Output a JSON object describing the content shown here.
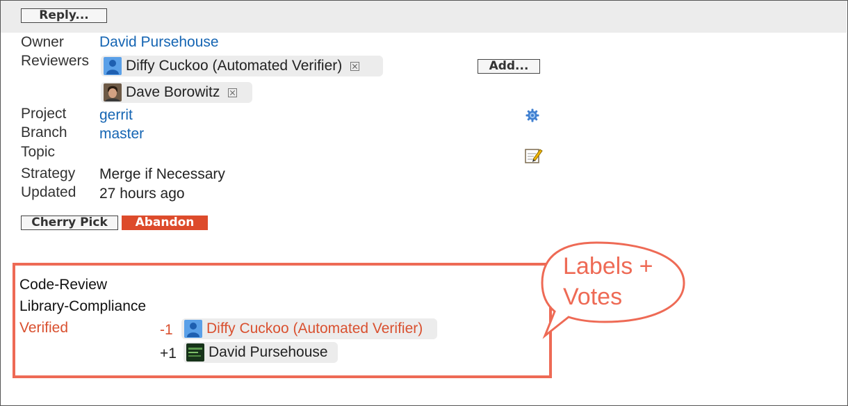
{
  "toolbar": {
    "reply_label": "Reply..."
  },
  "change": {
    "owner": {
      "label": "Owner",
      "value": "David Pursehouse"
    },
    "reviewers": {
      "label": "Reviewers",
      "add_label": "Add...",
      "items": [
        {
          "name": "Diffy Cuckoo (Automated Verifier)",
          "avatar": "default-user-icon"
        },
        {
          "name": "Dave Borowitz",
          "avatar": "photo-avatar"
        }
      ]
    },
    "project": {
      "label": "Project",
      "value": "gerrit"
    },
    "branch": {
      "label": "Branch",
      "value": "master"
    },
    "topic": {
      "label": "Topic",
      "value": ""
    },
    "strategy": {
      "label": "Strategy",
      "value": "Merge if Necessary"
    },
    "updated": {
      "label": "Updated",
      "value": "27 hours ago"
    }
  },
  "actions": {
    "cherry_pick_label": "Cherry Pick",
    "abandon_label": "Abandon"
  },
  "labels": {
    "items": [
      {
        "name": "Code-Review",
        "votes": []
      },
      {
        "name": "Library-Compliance",
        "votes": []
      },
      {
        "name": "Verified",
        "status": "rejected",
        "votes": [
          {
            "value": "-1",
            "voter": "Diffy Cuckoo (Automated Verifier)",
            "avatar": "default-user-icon"
          },
          {
            "value": "+1",
            "voter": "David Pursehouse",
            "avatar": "photo-avatar"
          }
        ]
      }
    ]
  },
  "callout": {
    "line1": "Labels +",
    "line2": "Votes"
  },
  "colors": {
    "link": "#1565b3",
    "abandon": "#dd4b2b",
    "rejected": "#d9502f",
    "highlight": "#ee6a55"
  },
  "icons": {
    "project_settings": "gear-icon",
    "topic_edit": "edit-pencil-icon"
  }
}
